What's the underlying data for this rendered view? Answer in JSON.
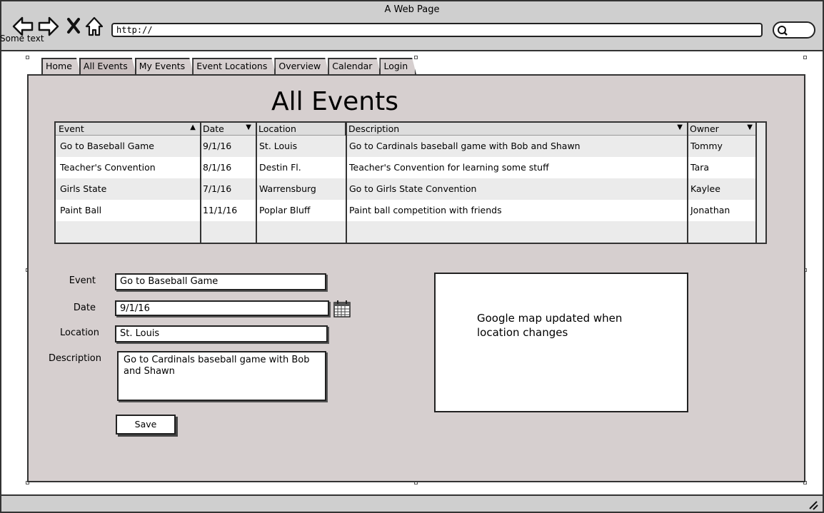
{
  "window": {
    "title": "A Web Page",
    "url": "http://",
    "sidebar_text": "Some text"
  },
  "tabs": [
    "Home",
    "All Events",
    "My Events",
    "Event Locations",
    "Overview",
    "Calendar",
    "Login"
  ],
  "active_tab": "All Events",
  "page_title": "All Events",
  "table": {
    "headers": [
      "Event",
      "Date",
      "Location",
      "Description",
      "Owner"
    ],
    "rows": [
      [
        "Go to Baseball Game",
        "9/1/16",
        "St. Louis",
        "Go to Cardinals baseball game with Bob and Shawn",
        "Tommy"
      ],
      [
        "Teacher's Convention",
        "8/1/16",
        "Destin Fl.",
        "Teacher's Convention for learning some stuff",
        "Tara"
      ],
      [
        "Girls State",
        "7/1/16",
        "Warrensburg",
        "Go to Girls State Convention",
        "Kaylee"
      ],
      [
        "Paint Ball",
        "11/1/16",
        "Poplar Bluff",
        "Paint ball competition with friends",
        "Jonathan"
      ]
    ]
  },
  "form": {
    "event_label": "Event",
    "event_value": "Go to Baseball Game",
    "date_label": "Date",
    "date_value": "9/1/16",
    "location_label": "Location",
    "location_value": "St. Louis",
    "description_label": "Description",
    "description_value": "Go to Cardinals baseball game with Bob and Shawn",
    "save_label": "Save"
  },
  "map": {
    "text": "Google map updated when location changes"
  },
  "colors": {
    "page_bg": "#d6cfcf",
    "chrome": "#cfcfcf"
  }
}
